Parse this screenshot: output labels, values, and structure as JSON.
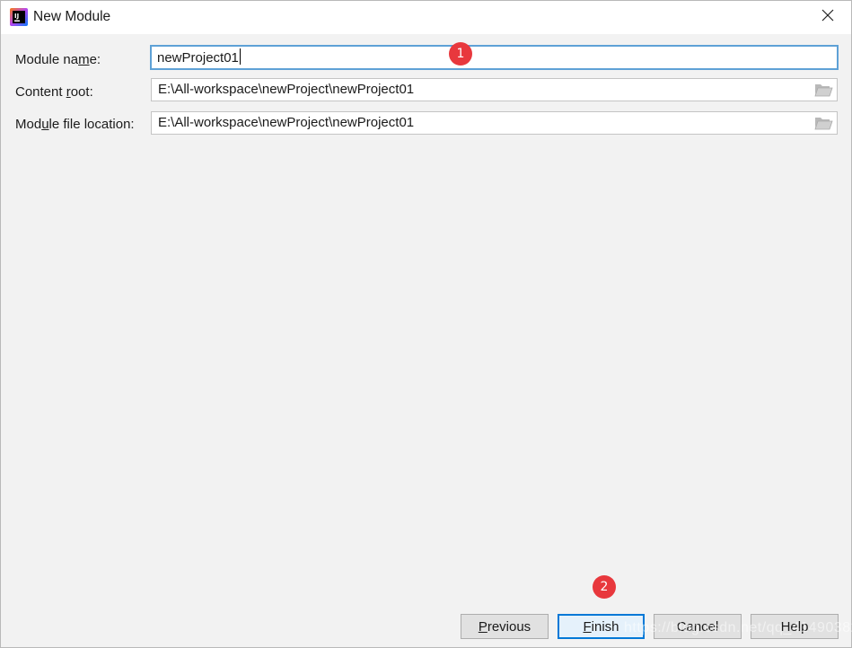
{
  "window": {
    "title": "New Module"
  },
  "form": {
    "module_name": {
      "label_pre": "Module na",
      "label_mnemonic": "m",
      "label_post": "e:",
      "value": "newProject01"
    },
    "content_root": {
      "label_pre": "Content ",
      "label_mnemonic": "r",
      "label_post": "oot:",
      "value": "E:\\All-workspace\\newProject\\newProject01"
    },
    "module_file_location": {
      "label_pre": "Mod",
      "label_mnemonic": "u",
      "label_post": "le file location:",
      "value": "E:\\All-workspace\\newProject\\newProject01"
    }
  },
  "annotations": {
    "badge_1": "1",
    "badge_2": "2",
    "badge_color": "#e8383d"
  },
  "buttons": {
    "previous": {
      "mnemonic": "P",
      "rest": "revious"
    },
    "finish": {
      "mnemonic": "F",
      "rest": "inish"
    },
    "cancel": {
      "label": "Cancel"
    },
    "help": {
      "label": "Help"
    }
  },
  "watermark": "https://blog.csdn.net/qq_41490382",
  "icons": {
    "app": "intellij-idea-icon",
    "close": "close-icon",
    "folder": "folder-open-icon"
  },
  "colors": {
    "focus_border": "#5ea1d6",
    "default_button_border": "#0078d7",
    "dialog_background": "#f2f2f2"
  }
}
